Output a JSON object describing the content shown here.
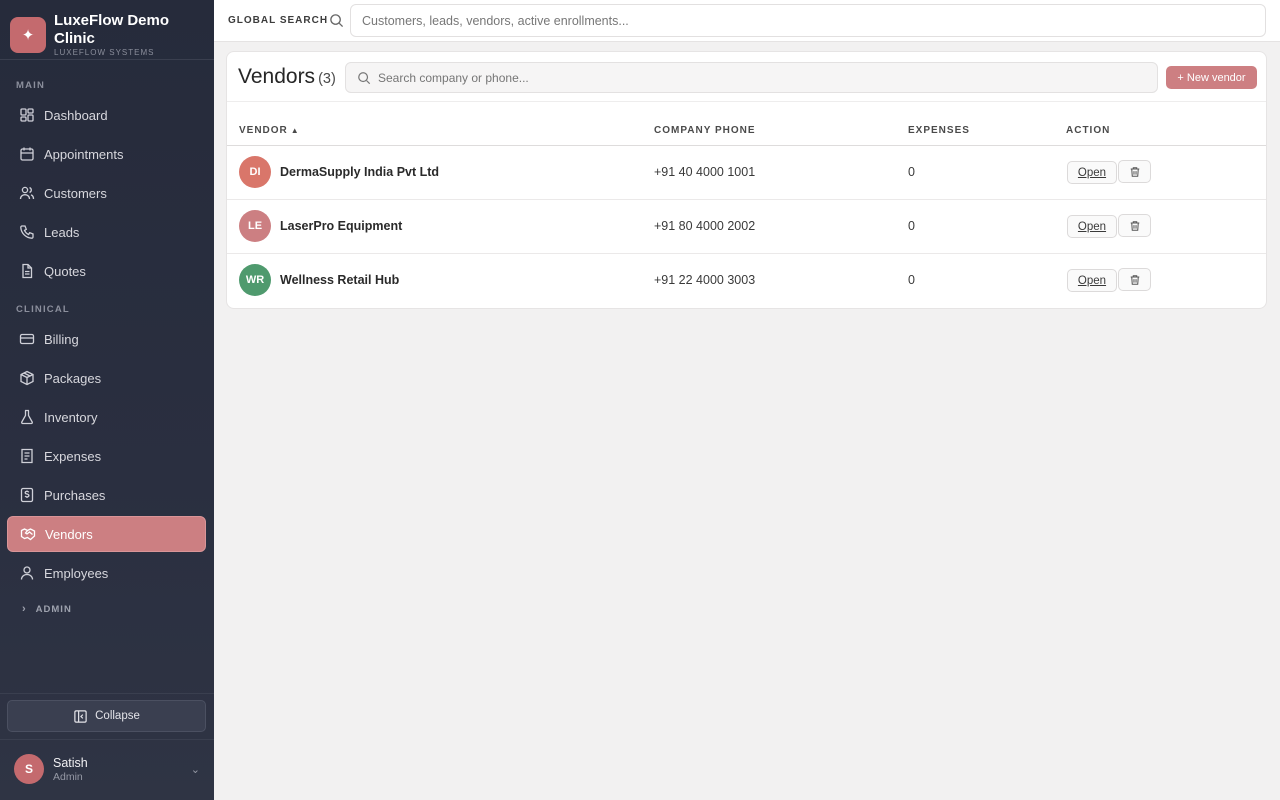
{
  "app": {
    "brand_title": "LuxeFlow Demo Clinic",
    "brand_subtitle": "LUXEFLOW SYSTEMS",
    "brand_color": "#c46a6e"
  },
  "sidebar": {
    "sections": {
      "main": "MAIN",
      "clinical": "CLINICAL",
      "admin": "ADMIN"
    },
    "items": [
      {
        "label": "Dashboard",
        "icon": "dashboard-icon"
      },
      {
        "label": "Appointments",
        "icon": "calendar-icon"
      },
      {
        "label": "Customers",
        "icon": "users-icon"
      },
      {
        "label": "Leads",
        "icon": "phone-icon"
      },
      {
        "label": "Quotes",
        "icon": "document-icon"
      },
      {
        "label": "Billing",
        "icon": "credit-card-icon"
      },
      {
        "label": "Packages",
        "icon": "package-icon"
      },
      {
        "label": "Inventory",
        "icon": "flask-icon"
      },
      {
        "label": "Expenses",
        "icon": "receipt-icon"
      },
      {
        "label": "Purchases",
        "icon": "dollar-icon"
      },
      {
        "label": "Vendors",
        "icon": "handshake-icon",
        "active": true
      },
      {
        "label": "Employees",
        "icon": "user-icon"
      }
    ],
    "collapse_label": "Collapse",
    "user": {
      "initial": "S",
      "name": "Satish",
      "role": "Admin"
    }
  },
  "topbar": {
    "search_label": "GLOBAL SEARCH",
    "search_placeholder": "Customers, leads, vendors, active enrollments..."
  },
  "page": {
    "title": "Vendors",
    "count": "(3)",
    "search_placeholder": "Search company or phone...",
    "new_button": "+ New vendor",
    "columns": {
      "vendor": "VENDOR",
      "sort_indicator": "▲",
      "phone": "COMPANY PHONE",
      "expenses": "EXPENSES",
      "action": "ACTION"
    },
    "rows": [
      {
        "initials": "DI",
        "name": "DermaSupply India Pvt Ltd",
        "phone": "+91 40 4000 1001",
        "expenses": "0",
        "avatar_color": "#d9766a",
        "open": "Open"
      },
      {
        "initials": "LE",
        "name": "LaserPro Equipment",
        "phone": "+91 80 4000 2002",
        "expenses": "0",
        "avatar_color": "#cc7f82",
        "open": "Open"
      },
      {
        "initials": "WR",
        "name": "Wellness Retail Hub",
        "phone": "+91 22 4000 3003",
        "expenses": "0",
        "avatar_color": "#4f9a6e",
        "open": "Open"
      }
    ]
  }
}
